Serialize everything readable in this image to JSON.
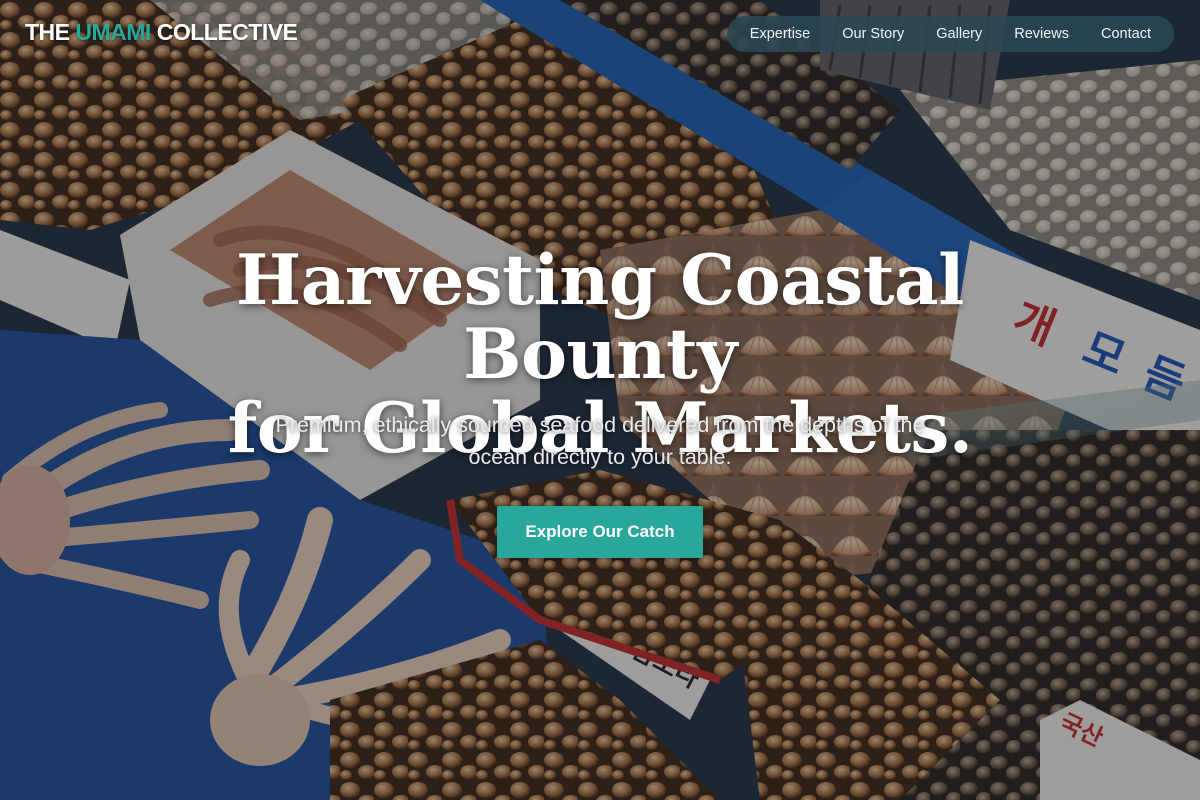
{
  "logo": {
    "prefix": "THE ",
    "accent": "UMAMI",
    "suffix": " COLLECTIVE"
  },
  "nav": {
    "items": [
      {
        "label": "Expertise"
      },
      {
        "label": "Our Story"
      },
      {
        "label": "Gallery"
      },
      {
        "label": "Reviews"
      },
      {
        "label": "Contact"
      }
    ]
  },
  "hero": {
    "title_line1": "Harvesting Coastal Bounty",
    "title_line2": "for Global Markets.",
    "subtitle": "Premium, ethically sourced seafood delivered from the depths of the ocean directly to your table.",
    "cta_label": "Explore Our Catch",
    "background_image": "seafood-market-stalls-photo"
  },
  "colors": {
    "accent": "#2aa79b",
    "nav_background": "#2a4854",
    "text": "#ffffff"
  }
}
